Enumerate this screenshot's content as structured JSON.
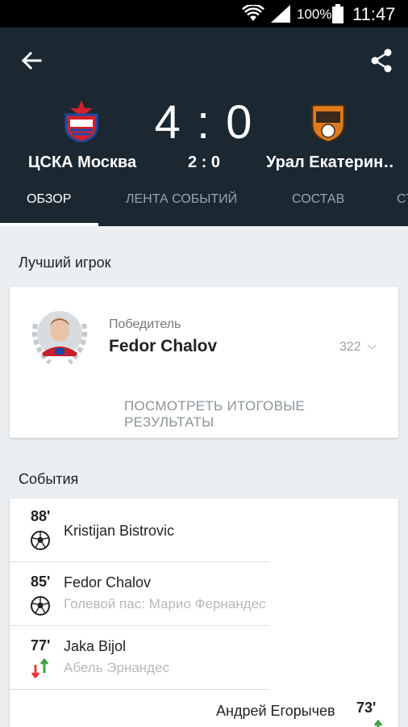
{
  "status_bar": {
    "battery_percent": "100%",
    "time": "11:47"
  },
  "header": {
    "home_team": "ЦСКА Москва",
    "away_team": "Урал Екатерин…",
    "score_home": "4",
    "score_sep": ":",
    "score_away": "0",
    "halftime_score": "2 : 0",
    "colors": {
      "background": "#1b2832",
      "home_logo_red": "#d4202a",
      "away_logo_orange": "#e07a1e"
    }
  },
  "tabs": [
    {
      "label": "ОБЗОР",
      "active": true
    },
    {
      "label": "ЛЕНТА СОБЫТИЙ",
      "active": false
    },
    {
      "label": "СОСТАВ",
      "active": false
    },
    {
      "label": "СТ",
      "active": false
    }
  ],
  "best_player": {
    "section_title": "Лучший игрок",
    "winner_label": "Победитель",
    "winner_name": "Fedor Chalov",
    "votes": "322",
    "results_link": "ПОСМОТРЕТЬ ИТОГОВЫЕ РЕЗУЛЬТАТЫ"
  },
  "events": {
    "section_title": "События",
    "items": [
      {
        "minute": "88'",
        "icon": "goal-icon",
        "player": "Kristijan Bistrovic",
        "detail": ""
      },
      {
        "minute": "85'",
        "icon": "goal-icon",
        "player": "Fedor Chalov",
        "detail": "Голевой пас: Марио Фернандес"
      },
      {
        "minute": "77'",
        "icon": "substitution-icon",
        "player": "Jaka Bijol",
        "detail": "Абель Эрнандес"
      }
    ],
    "away_event": {
      "minute": "73'",
      "player": "Андрей Егорычев",
      "icon": "substitution-icon"
    }
  }
}
